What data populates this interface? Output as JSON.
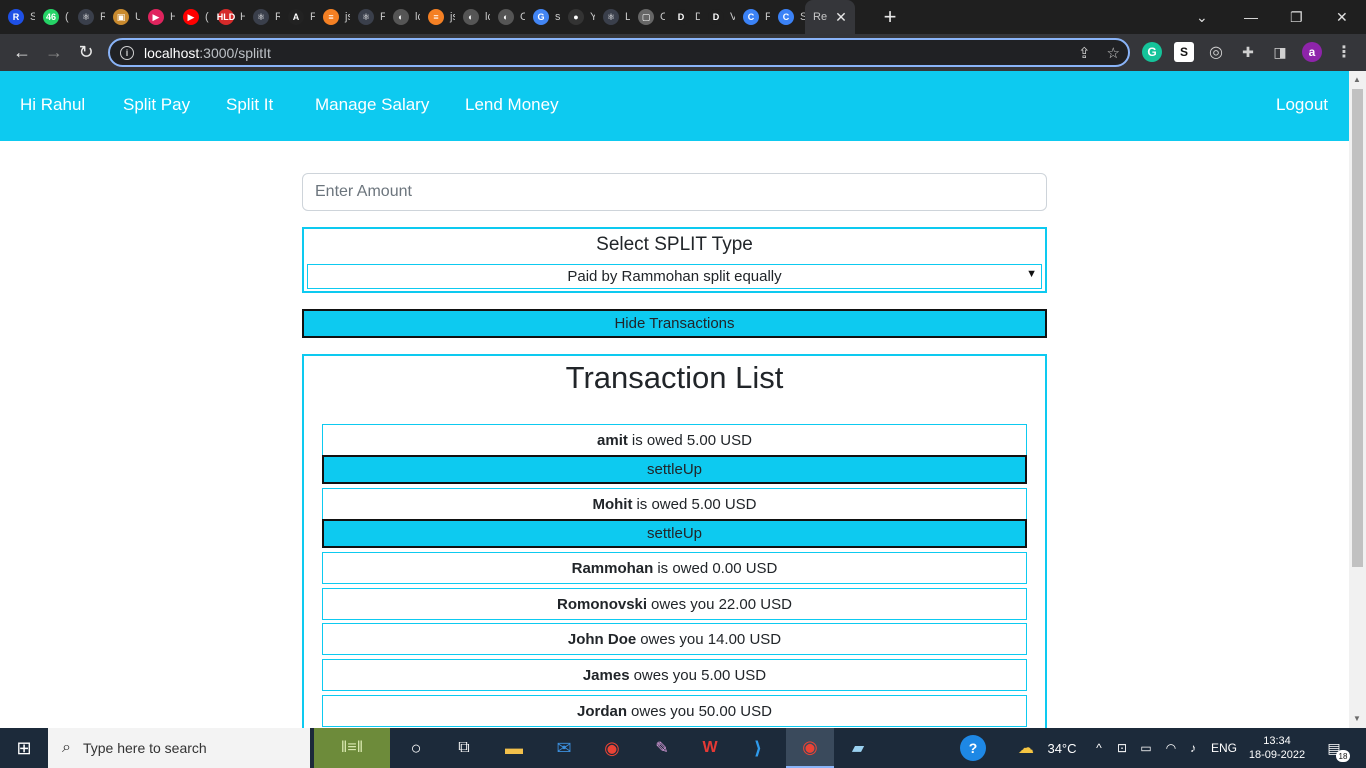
{
  "browser": {
    "tabs": [
      {
        "letter": "S",
        "icon": "R",
        "color": "#1e50e6"
      },
      {
        "letter": "(",
        "icon": "46",
        "color": "#25d366"
      },
      {
        "letter": "R",
        "icon": "⚛",
        "color": "#3a3f4b"
      },
      {
        "letter": "U",
        "icon": "▣",
        "color": "#c98a2e"
      },
      {
        "letter": "H",
        "icon": "▶",
        "color": "#e0245e"
      },
      {
        "letter": "(",
        "icon": "▶",
        "color": "#ff0000"
      },
      {
        "letter": "H",
        "icon": "HLD",
        "color": "#d52a2a"
      },
      {
        "letter": "R",
        "icon": "⚛",
        "color": "#3a3f4b"
      },
      {
        "letter": "F",
        "icon": "A",
        "color": "#222222"
      },
      {
        "letter": "js",
        "icon": "≡",
        "color": "#f48024"
      },
      {
        "letter": "F",
        "icon": "⚛",
        "color": "#3a3f4b"
      },
      {
        "letter": "lc",
        "icon": "◐",
        "color": "#555555"
      },
      {
        "letter": "js",
        "icon": "≡",
        "color": "#f48024"
      },
      {
        "letter": "lc",
        "icon": "◐",
        "color": "#555555"
      },
      {
        "letter": "C",
        "icon": "◐",
        "color": "#555555"
      },
      {
        "letter": "s",
        "icon": "G",
        "color": "#4285f4"
      },
      {
        "letter": "Y",
        "icon": "●",
        "color": "#333333"
      },
      {
        "letter": "L",
        "icon": "⚛",
        "color": "#3a3f4b"
      },
      {
        "letter": "C",
        "icon": "▢",
        "color": "#666666"
      },
      {
        "letter": "D",
        "icon": "D",
        "color": "#1f1f1f"
      },
      {
        "letter": "V",
        "icon": "D",
        "color": "#1f1f1f"
      },
      {
        "letter": "F",
        "icon": "C",
        "color": "#3b82f6"
      },
      {
        "letter": "S",
        "icon": "C",
        "color": "#3b82f6"
      }
    ],
    "active_tab_title": "Re",
    "url_host": "localhost",
    "url_path": ":3000/splitIt"
  },
  "nav": {
    "greeting": "Hi Rahul",
    "split_pay": "Split Pay",
    "split_it": "Split It",
    "manage_salary": "Manage Salary",
    "lend_money": "Lend Money",
    "logout": "Logout"
  },
  "form": {
    "amount_placeholder": "Enter Amount",
    "split_heading": "Select SPLIT Type",
    "split_selected": "Paid by Rammohan split equally",
    "hide_button": "Hide Transactions"
  },
  "transactions": {
    "title": "Transaction List",
    "settle_label": "settleUp",
    "items": [
      {
        "name": "amit",
        "text": "is owed 5.00 USD"
      },
      {
        "name": "Mohit",
        "text": "is owed 5.00 USD"
      },
      {
        "name": "Rammohan",
        "text": "is owed 0.00 USD"
      },
      {
        "name": "Romonovski",
        "text": "owes you 22.00 USD"
      },
      {
        "name": "John Doe",
        "text": "owes you 14.00 USD"
      },
      {
        "name": "James",
        "text": "owes you 5.00 USD"
      },
      {
        "name": "Jordan",
        "text": "owes you 50.00 USD"
      }
    ]
  },
  "taskbar": {
    "search_placeholder": "Type here to search",
    "temperature": "34°C",
    "language": "ENG",
    "time": "13:34",
    "date": "18-09-2022",
    "notifications": "18"
  },
  "colors": {
    "accent": "#0dcaf0",
    "chrome_dark": "#1f1f1f",
    "toolbar": "#35363a"
  }
}
